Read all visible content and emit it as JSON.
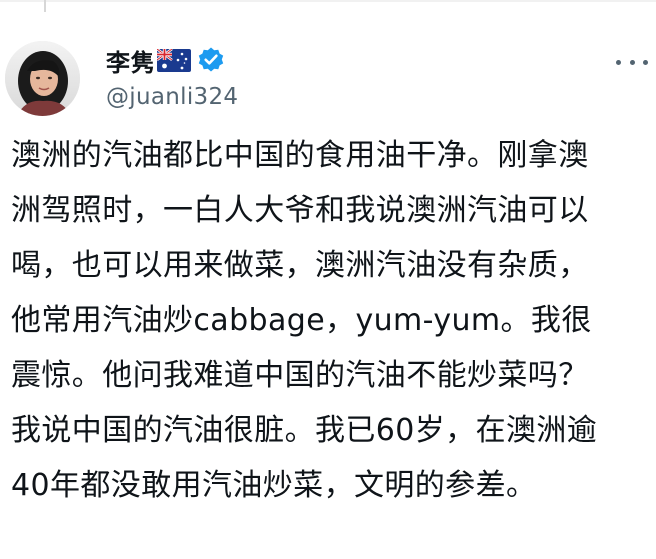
{
  "author": {
    "display_name": "李隽",
    "handle": "@juanli324",
    "flag_icon": "australia-flag-icon",
    "verified_icon": "verified-badge-icon",
    "verified_color": "#1d9bf0"
  },
  "menu": {
    "icon": "more-options-icon"
  },
  "post": {
    "lines": [
      "澳洲的汽油都比中国的食用油干净。刚拿澳",
      "洲驾照时，一白人大爷和我说澳洲汽油可以",
      "喝，也可以用来做菜，澳洲汽油没有杂质，",
      "他常用汽油炒cabbage，yum-yum。我很",
      "震惊。他问我难道中国的汽油不能炒菜吗？",
      "我说中国的汽油很脏。我已60岁，在澳洲逾",
      "40年都没敢用汽油炒菜，文明的参差。"
    ]
  },
  "colors": {
    "text": "#0f1419",
    "secondary_text": "#536471",
    "accent": "#1d9bf0"
  }
}
